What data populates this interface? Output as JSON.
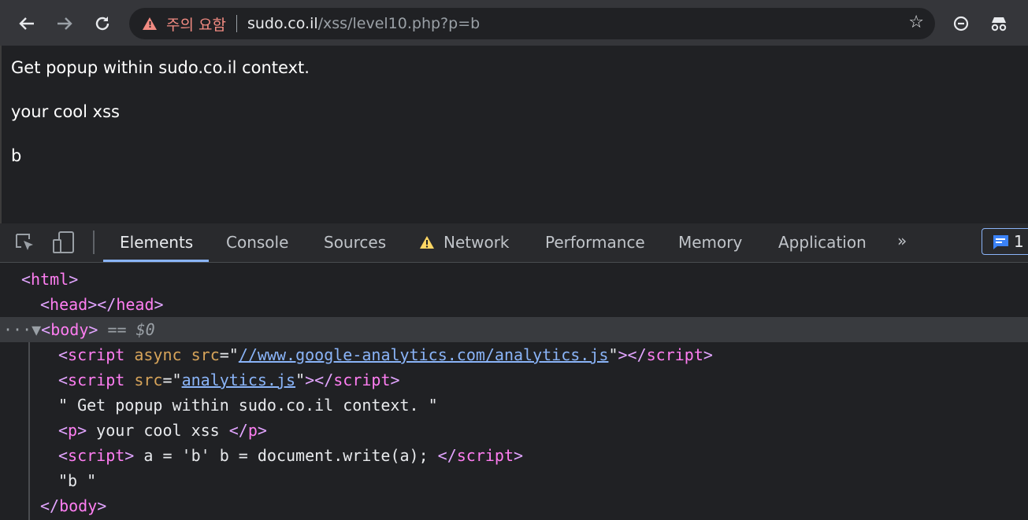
{
  "browser": {
    "security_warning": "주의 요함",
    "url_host": "sudo.co.il",
    "url_path": "/xss/level10.php?p=b",
    "icons": [
      "back-arrow-icon",
      "forward-arrow-icon",
      "reload-icon",
      "warning-triangle-icon",
      "bookmark-star-icon",
      "minus-circle-icon",
      "incognito-icon"
    ]
  },
  "page": {
    "line1": "Get popup within sudo.co.il context.",
    "line2": "your cool xss",
    "line3": "b"
  },
  "devtools": {
    "tabs": [
      "Elements",
      "Console",
      "Sources",
      "Network",
      "Performance",
      "Memory",
      "Application"
    ],
    "more": "»",
    "issues_count": "1",
    "accent": "#8ab4f8"
  },
  "dom": {
    "html_tag": "html",
    "head_tag": "head",
    "body_tag": "body",
    "selected_marker": "== $0",
    "script1_attr_async": "async",
    "script1_src": "//www.google-analytics.com/analytics.js",
    "script2_src": "analytics.js",
    "text_node1": "\" Get popup within sudo.co.il context. \"",
    "p_text": " your cool xss ",
    "script3_text": " a = 'b' b = document.write(a); ",
    "text_node2": "\"b \""
  }
}
